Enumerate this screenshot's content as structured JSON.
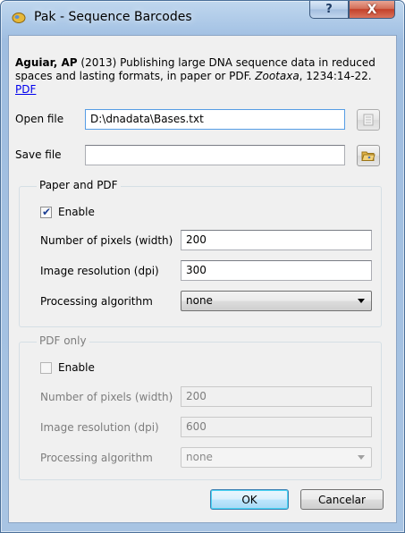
{
  "window": {
    "title": "Pak - Sequence Barcodes",
    "help_label": "?",
    "close_label": "X"
  },
  "citation": {
    "author": "Aguiar, AP",
    "text": " (2013) Publishing large DNA sequence data in reduced spaces and lasting formats, in paper or PDF. ",
    "journal": "Zootaxa",
    "pages": ", 1234:14-22. ",
    "link": "PDF"
  },
  "open_file": {
    "label": "Open file",
    "value": "D:\\dnadata\\Bases.txt",
    "browse_icon": "document-icon"
  },
  "save_file": {
    "label": "Save file",
    "value": "",
    "browse_icon": "open-folder-icon"
  },
  "paper_pdf": {
    "title": "Paper and PDF",
    "enable_label": "Enable",
    "enabled": true,
    "width_label": "Number of pixels (width)",
    "width_value": "200",
    "resolution_label": "Image resolution (dpi)",
    "resolution_value": "300",
    "algorithm_label": "Processing algorithm",
    "algorithm_value": "none"
  },
  "pdf_only": {
    "title": "PDF only",
    "enable_label": "Enable",
    "enabled": false,
    "width_label": "Number of pixels (width)",
    "width_value": "200",
    "resolution_label": "Image resolution (dpi)",
    "resolution_value": "600",
    "algorithm_label": "Processing algorithm",
    "algorithm_value": "none"
  },
  "buttons": {
    "ok": "OK",
    "cancel": "Cancelar"
  }
}
